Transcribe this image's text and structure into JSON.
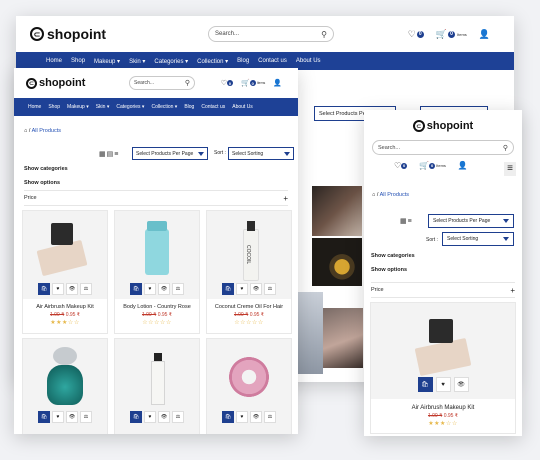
{
  "brand": "shopoint",
  "search_placeholder": "Search...",
  "cart_count": "0",
  "wish_count": "0",
  "cart_items_label": "Items",
  "nav": [
    "Home",
    "Shop",
    "Makeup ▾",
    "Skin ▾",
    "Categories ▾",
    "Collection ▾",
    "Blog",
    "Contact us",
    "About Us"
  ],
  "breadcrumb_sep": "/",
  "breadcrumb_current": "All Products",
  "per_page_label": "Select Products Per Page",
  "sort_label": "Sort :",
  "sort_select": "Select Sorting",
  "filters": {
    "categories": "Show categories",
    "options": "Show options",
    "price": "Price",
    "plus": "+"
  },
  "products": [
    {
      "name": "Air Airbrush Makeup Kit",
      "old": "1.00 ₹",
      "new": "0.95 ₹",
      "stars": "★★★☆☆"
    },
    {
      "name": "Body Lotion - Country Rose",
      "old": "1.00 ₹",
      "new": "0.95 ₹",
      "stars": "☆☆☆☆☆"
    },
    {
      "name": "Coconut Creme Oil For Hair",
      "old": "1.00 ₹",
      "new": "0.95 ₹",
      "stars": "☆☆☆☆☆"
    }
  ],
  "bottle_label": "COCOIL",
  "colors": {
    "primary": "#1e4196",
    "price": "#c0392b",
    "star": "#e6b84a"
  }
}
